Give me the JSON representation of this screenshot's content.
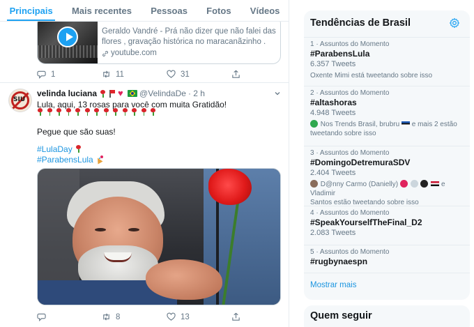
{
  "tabs": [
    {
      "label": "Principais",
      "active": true
    },
    {
      "label": "Mais recentes",
      "active": false
    },
    {
      "label": "Pessoas",
      "active": false
    },
    {
      "label": "Fotos",
      "active": false
    },
    {
      "label": "Vídeos",
      "active": false
    }
  ],
  "prev_tweet": {
    "card": {
      "description_line1": "Geraldo Vandré - Prá não dizer que não falei das",
      "description_line2": "flores , gravação histórica no maracanãzinho .",
      "domain": "youtube.com"
    },
    "actions": {
      "replies": "1",
      "retweets": "11",
      "likes": "31"
    }
  },
  "tweet": {
    "name": "velinda luciana",
    "handle": "@VelindaDe",
    "time": "· 2 h",
    "line1": "Lula, aqui, 13 rosas para você com muita Gratidão!",
    "roses_count": 13,
    "line2": "Pegue que são suas!",
    "hashtag1": "#LulaDay",
    "hashtag2": "#ParabensLula",
    "actions": {
      "replies": "",
      "retweets": "8",
      "likes": "13"
    }
  },
  "trends_panel": {
    "title": "Tendências de Brasil",
    "items": [
      {
        "meta": "1 · Assuntos do Momento",
        "name": "#ParabensLula",
        "count": "6.357 Tweets",
        "context": "Oxente Mimi está tweetando sobre isso"
      },
      {
        "meta": "2 · Assuntos do Momento",
        "name": "#altashoras",
        "count": "4.948 Tweets",
        "context_a": "Nos Trends Brasil, brubru",
        "context_b": "e mais 2 estão tweetando sobre isso"
      },
      {
        "meta": "3 · Assuntos do Momento",
        "name": "#DomingoDetremuraSDV",
        "count": "2.404 Tweets",
        "context_a": "D@nny Carmo (Danielly)",
        "context_b": "e Vladimir",
        "context_c": "Santos estão tweetando sobre isso"
      },
      {
        "meta": "4 · Assuntos do Momento",
        "name": "#SpeakYourselfTheFinal_D2",
        "count": "2.083 Tweets"
      },
      {
        "meta": "5 · Assuntos do Momento",
        "name": "#rugbynaespn"
      }
    ],
    "show_more": "Mostrar mais"
  },
  "who_to_follow": {
    "title": "Quem seguir"
  },
  "colors": {
    "accent": "#1da1f2",
    "link": "#1b95e0",
    "muted": "#657786",
    "text": "#14171a",
    "panel": "#f5f8fa"
  },
  "icons": [
    "play-icon",
    "link-icon",
    "reply-icon",
    "retweet-icon",
    "like-icon",
    "share-icon",
    "caret-down-icon",
    "gear-icon"
  ]
}
